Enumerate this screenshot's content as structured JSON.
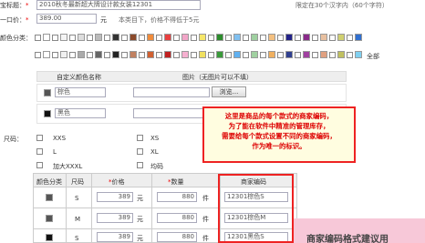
{
  "title_row": {
    "label": "宝标题：",
    "value": "2010秋冬最新超大牌设计款女装12301",
    "hint": "限定在30个汉字内（60个字符）"
  },
  "price_row": {
    "label": "一口价：",
    "value": "389.00",
    "unit": "元",
    "hint": "本类目下，价格不得低于5元"
  },
  "color_row": {
    "label": "颜色分类：",
    "all_label": "全部",
    "swatches_row1": [
      "#ffffff",
      "#f4f4f4",
      "#dddddd",
      "#bbbbbb",
      "#333333",
      "#8b4a2b",
      "#f08c3c",
      "#e84040",
      "#f2a6c8",
      "#f6e76a",
      "#2c8c2c",
      "#80c0f0",
      "#9fd0a0",
      "#f4c080",
      "#222288",
      "#8a2a8a",
      "#e8c0a0",
      "#d0d070",
      "#3070d0"
    ],
    "swatches_row2": [
      "#ffffff",
      "#f0f0f0",
      "#aaaaaa",
      "#666666",
      "#222222",
      "#c08060",
      "#d06030",
      "#c02020",
      "#f6b0d0",
      "#f0e060",
      "#3a9a3a",
      "#60b0f0",
      "#a0d0a0",
      "#f0b060",
      "#304090",
      "#a040a0",
      "#e0a080",
      "#c0c060",
      "#80d0f0"
    ],
    "header_name": "自定义颜色名称",
    "header_image": "图片（无图片可以不填）",
    "browse_label": "浏览...",
    "entries": [
      {
        "swatch": "#555555",
        "name": "棕色"
      },
      {
        "swatch": "#111111",
        "name": "黑色"
      }
    ]
  },
  "size_row": {
    "label": "尺码：",
    "options": [
      "XXS",
      "XS",
      "L",
      "XL",
      "加大XXXL",
      "均码"
    ]
  },
  "sku_table": {
    "headers": [
      "颜色分类",
      "尺码",
      "价格",
      "数量",
      "商家编码"
    ],
    "rows": [
      {
        "swatch": "#555555",
        "size": "S",
        "price": "389",
        "unit_price": "元",
        "qty": "880",
        "unit_qty": "件",
        "code": "12301棕色S"
      },
      {
        "swatch": "#555555",
        "size": "M",
        "price": "389",
        "unit_price": "元",
        "qty": "880",
        "unit_qty": "件",
        "code": "12301棕色M"
      },
      {
        "swatch": "#111111",
        "size": "S",
        "price": "389",
        "unit_price": "元",
        "qty": "880",
        "unit_qty": "件",
        "code": "12301黑色S"
      }
    ]
  },
  "callout": {
    "lines": [
      "这里是商品的每个款式的商家编码，",
      "为了能在软件中精准的管理库存，",
      "需要给每个款式设置不同的商家编码，",
      "作为唯一的标识。"
    ]
  },
  "banner": {
    "text": "商家编码格式建议用"
  },
  "colors": {
    "accent_red": "#e22222",
    "callout_bg": "#fffde0",
    "banner_bg": "#f7c8d8"
  }
}
